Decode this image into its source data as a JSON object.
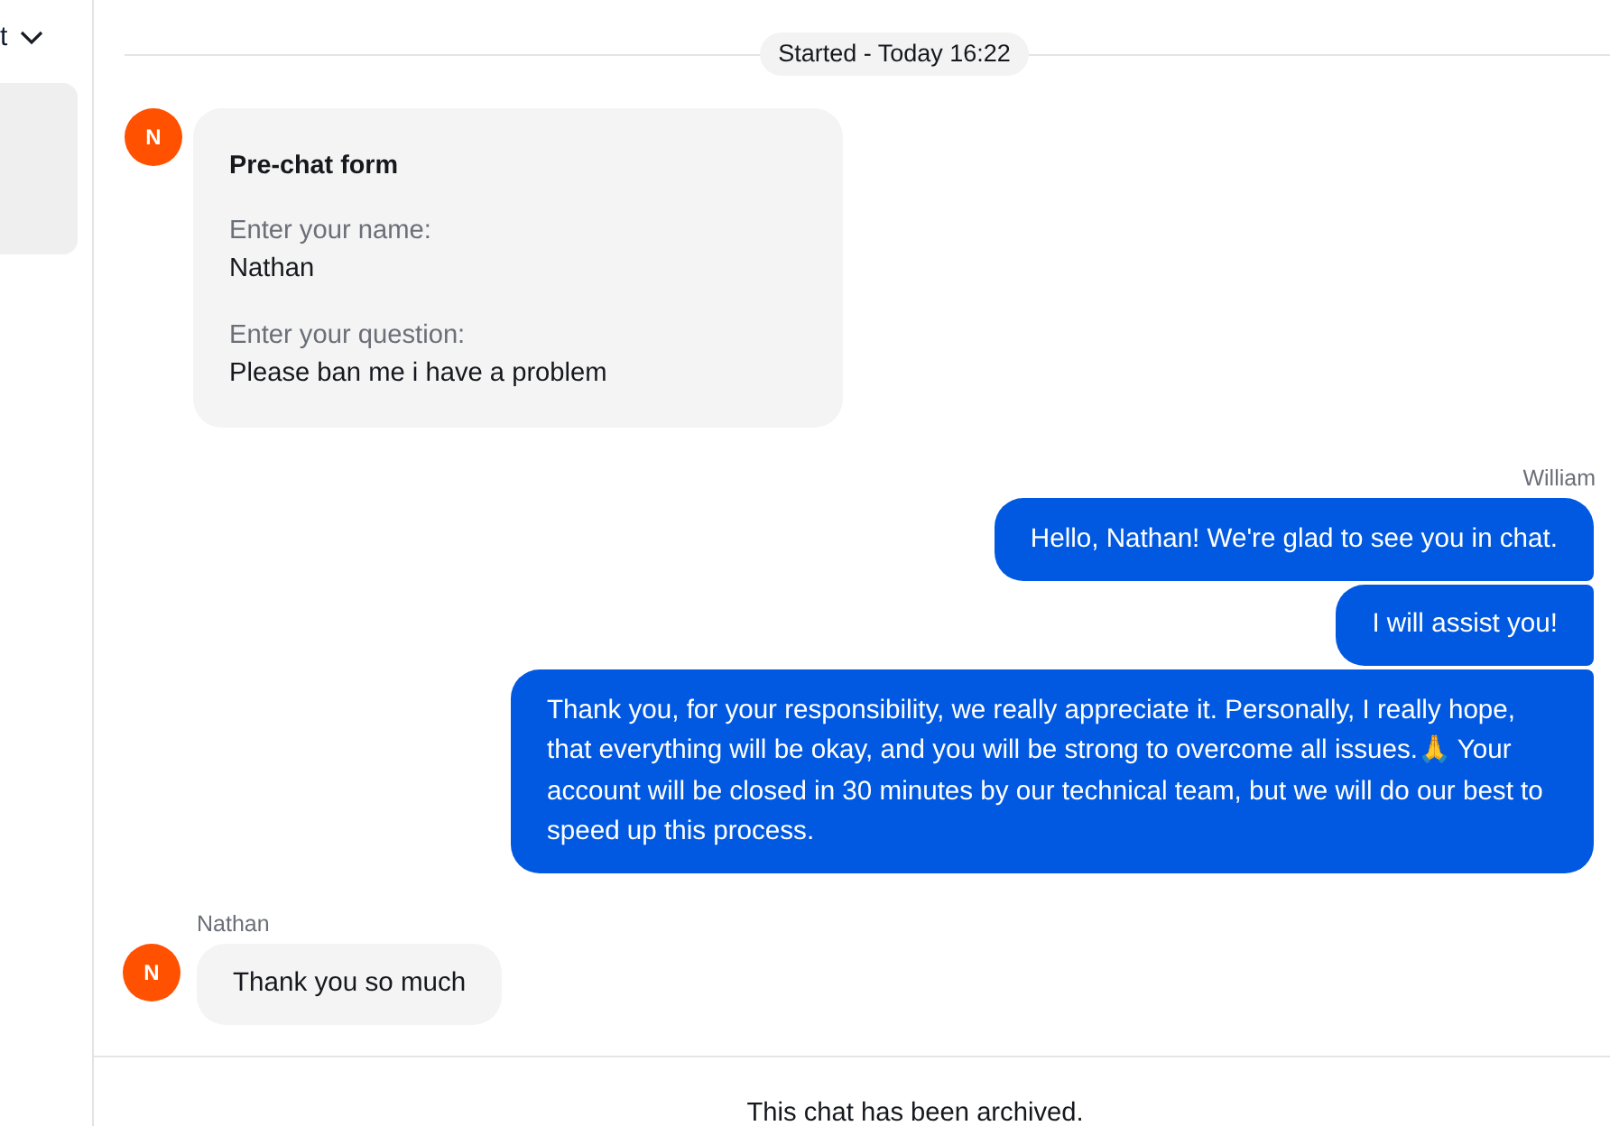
{
  "sidebar": {
    "dropdown": {
      "label": "t"
    }
  },
  "chat": {
    "started": "Started - Today 16:22",
    "messages": [
      {
        "kind": "form",
        "avatar": "N",
        "title": "Pre-chat form",
        "fields": [
          {
            "label": "Enter your name:",
            "value": "Nathan"
          },
          {
            "label": "Enter your question:",
            "value": "Please ban me i have a problem"
          }
        ]
      },
      {
        "kind": "agent",
        "author": "William",
        "bubbles": [
          "Hello, Nathan! We're glad to see you in chat.",
          "I will assist you!",
          "Thank you, for your responsibility, we really appreciate it. Personally, I really hope, that everything will be okay, and you will be strong to overcome all issues.🙏 Your account will be closed in 30 minutes by our technical team, but we will do our best to speed up this process."
        ]
      },
      {
        "kind": "visitor",
        "author": "Nathan",
        "avatar": "N",
        "bubbles": [
          "Thank you so much"
        ]
      }
    ],
    "notice": "This chat has been archived."
  }
}
